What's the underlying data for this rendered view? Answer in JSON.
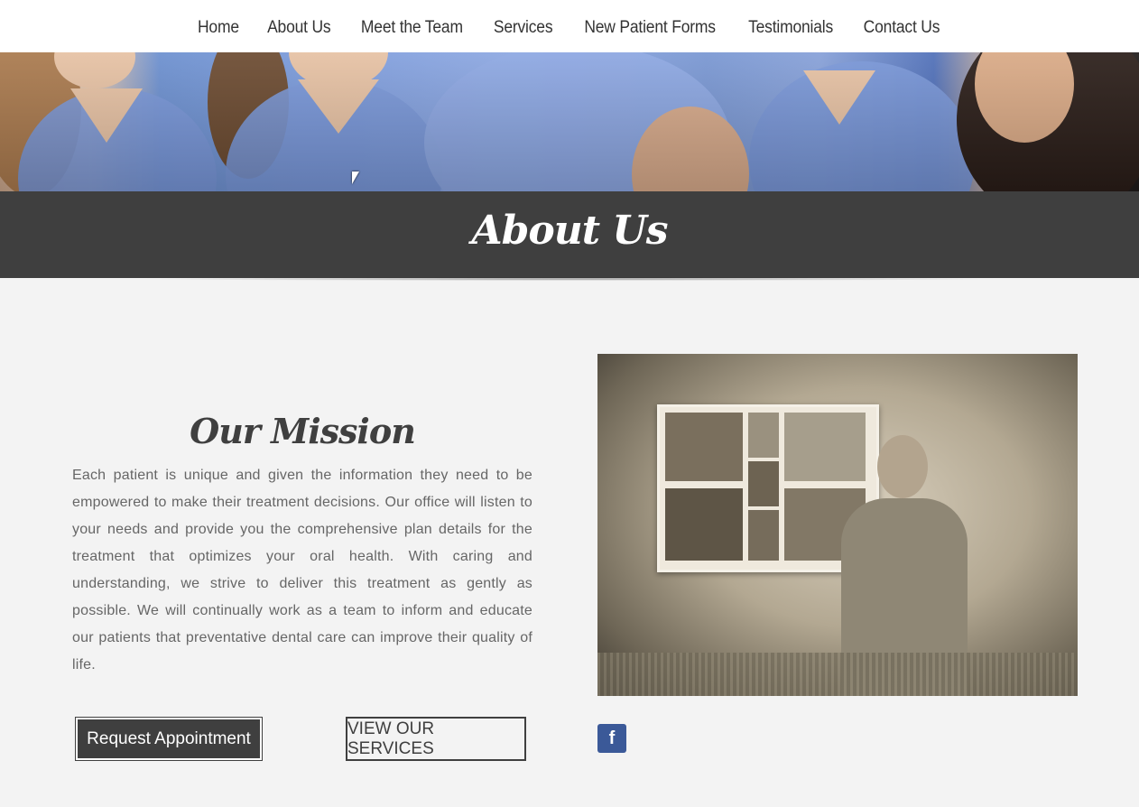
{
  "nav": {
    "items": [
      "Home",
      "About Us",
      "Meet the Team",
      "Services",
      "New Patient Forms",
      "Testimonials",
      "Contact Us"
    ]
  },
  "hero": {
    "alt": "Team of dental staff in blue scrubs"
  },
  "page": {
    "title": "About Us"
  },
  "mission": {
    "title": "Our Mission",
    "body": "Each patient is unique and given the information they need to be empowered to make their treatment decisions. Our office will listen to your needs and provide you the comprehensive plan details for the treatment that optimizes your oral health. With caring and understanding, we strive to deliver this treatment as gently as possible. We will continually work as a team to inform and educate our patients that preventative dental care can improve their quality of life."
  },
  "buttons": {
    "request": "Request Appointment",
    "services": "VIEW OUR SERVICES"
  },
  "social": {
    "facebook": "f"
  },
  "colors": {
    "dark": "#3f3f3f",
    "background": "#f3f3f3",
    "facebook": "#3b5998"
  }
}
